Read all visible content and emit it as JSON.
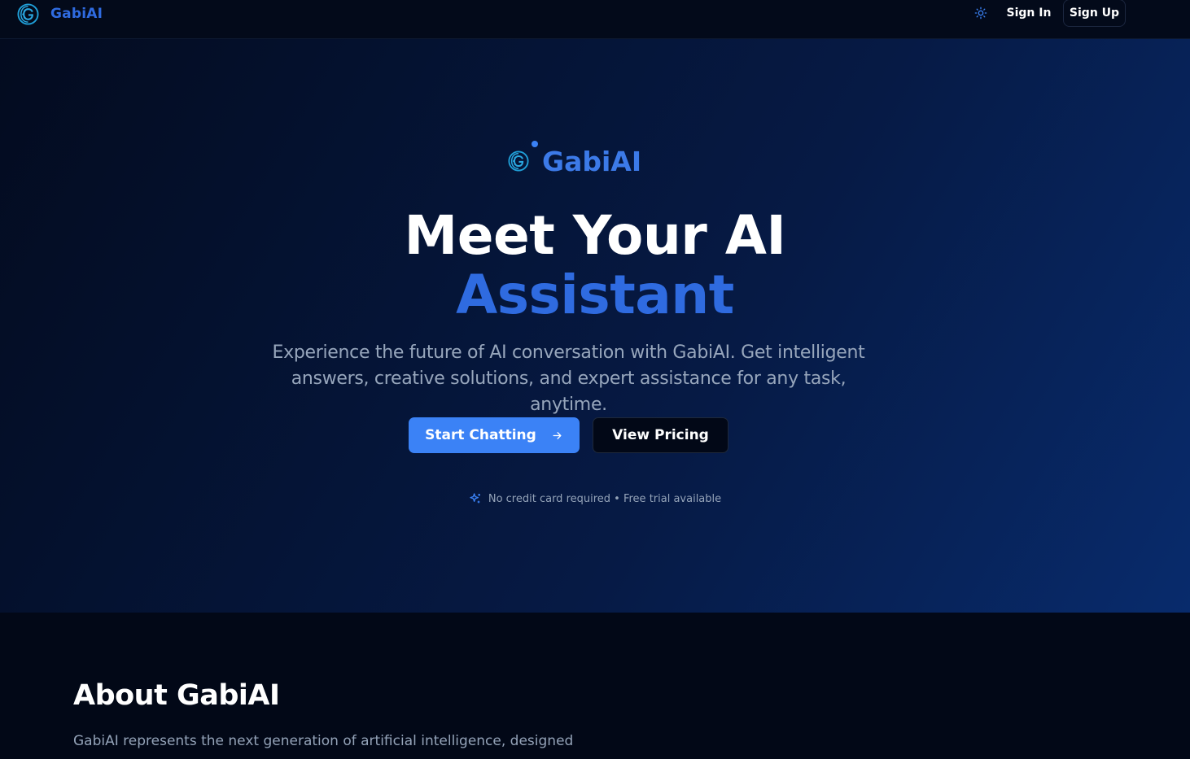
{
  "nav": {
    "brand_name": "GabiAI",
    "theme_icon": "sun-icon",
    "sign_in_label": "Sign In",
    "sign_up_label": "Sign Up"
  },
  "hero": {
    "brand_name": "GabiAI",
    "headline_line1": "Meet Your AI",
    "headline_line2": "Assistant",
    "subtitle": "Experience the future of AI conversation with GabiAI. Get intelligent answers, creative solutions, and expert assistance for any task, anytime.",
    "primary_button_label": "Start Chatting",
    "primary_button_icon": "arrow-right-icon",
    "secondary_button_label": "View Pricing",
    "note_icon": "sparkles-icon",
    "note_text": "No credit card required • Free trial available"
  },
  "about": {
    "title": "About GabiAI",
    "text": "GabiAI represents the next generation of artificial intelligence, designed"
  },
  "colors": {
    "accent": "#3b82f6",
    "brand_text": "#2f6be0",
    "background": "#020817",
    "muted_text": "#94a3b8"
  }
}
